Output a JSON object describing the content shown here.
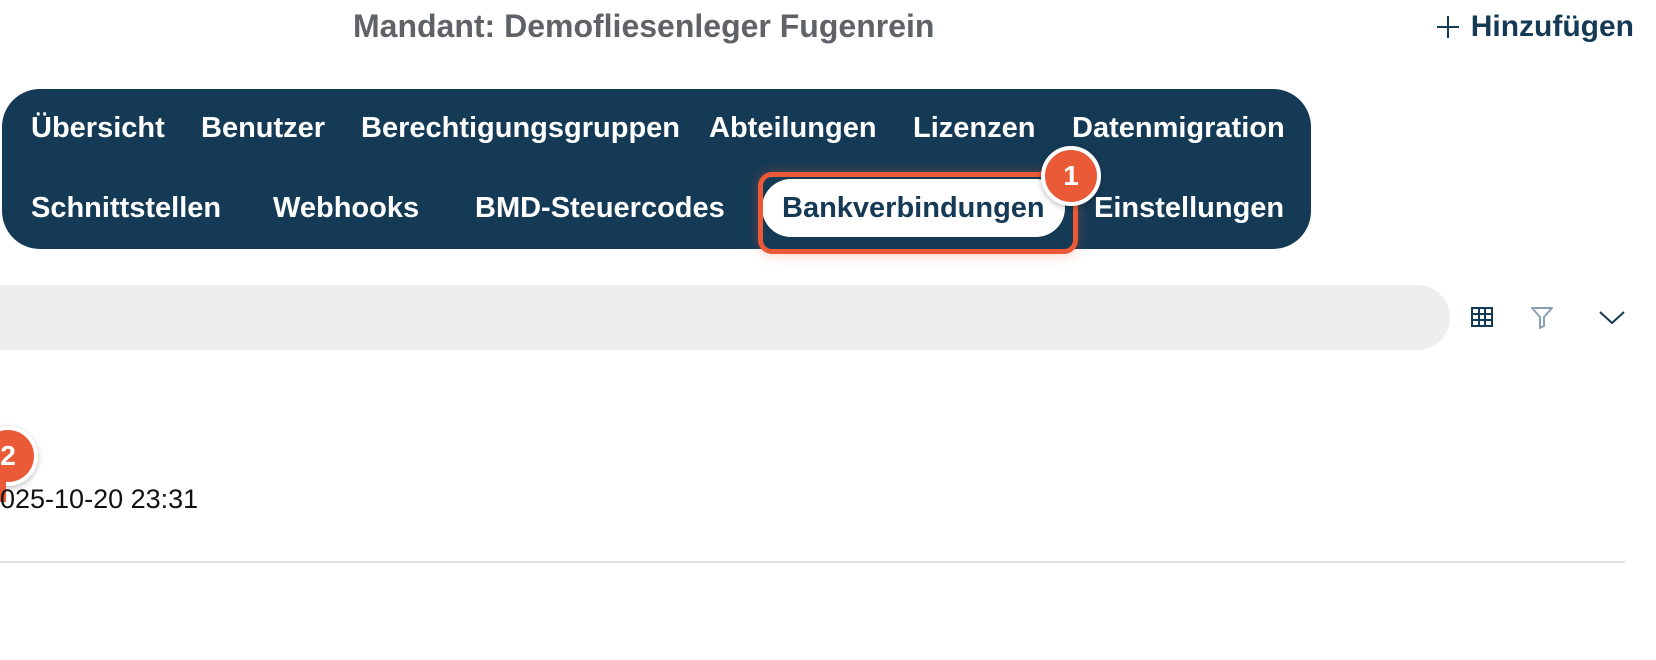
{
  "header": {
    "title": "Mandant: Demofliesenleger Fugenrein",
    "add_label": "Hinzufügen",
    "add_icon": "plus-icon"
  },
  "tabs": {
    "row1": [
      {
        "label": "Übersicht"
      },
      {
        "label": "Benutzer"
      },
      {
        "label": "Berechtigungsgruppen"
      },
      {
        "label": "Abteilungen"
      },
      {
        "label": "Lizenzen"
      },
      {
        "label": "Datenmigration"
      }
    ],
    "row2": [
      {
        "label": "Schnittstellen"
      },
      {
        "label": "Webhooks"
      },
      {
        "label": "BMD-Steuercodes"
      },
      {
        "label": "Bankverbindungen",
        "active": true
      },
      {
        "label": "Einstellungen"
      }
    ]
  },
  "annotations": {
    "step1": "1",
    "step2": "2"
  },
  "toolbar": {
    "columns_icon": "table-columns-icon",
    "filter_icon": "filter-icon",
    "expand_icon": "chevron-down-icon"
  },
  "table": {
    "rows": [
      {
        "date": "025-10-20 23:31"
      }
    ]
  },
  "colors": {
    "primary": "#153a56",
    "accent": "#ea5a37",
    "search_bg": "#eeeeee"
  }
}
